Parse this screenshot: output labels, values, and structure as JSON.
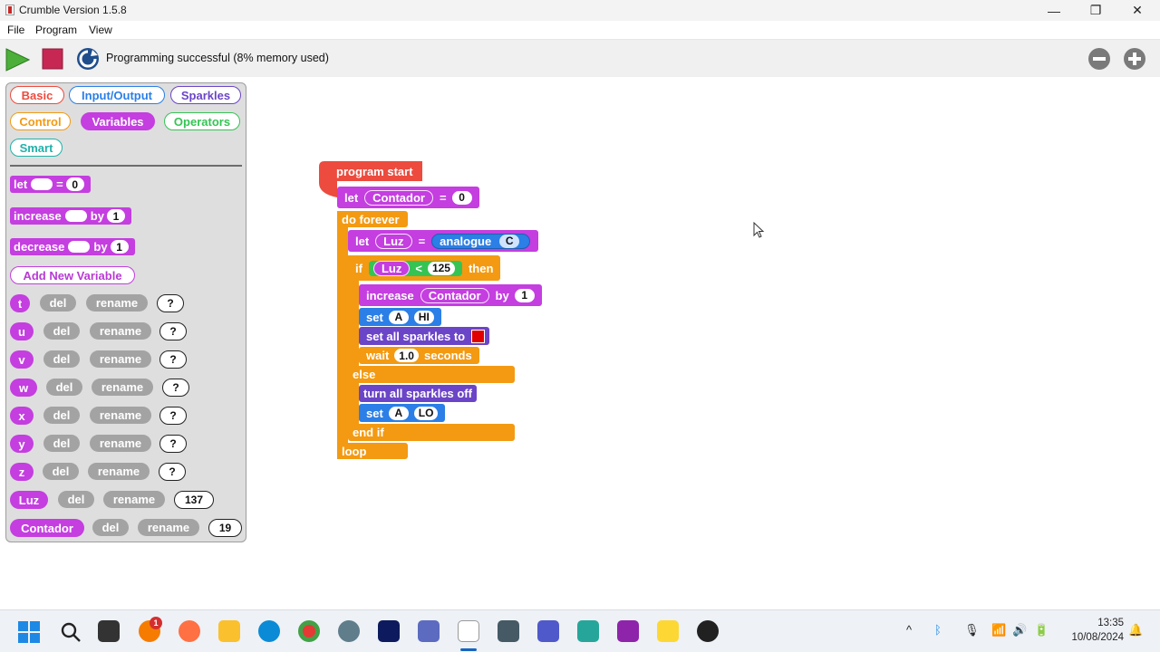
{
  "window": {
    "title": "Crumble Version 1.5.8",
    "minimize": "—",
    "maximize": "❐",
    "close": "✕"
  },
  "menu": [
    "File",
    "Program",
    "View"
  ],
  "toolbar": {
    "status": "Programming successful (8% memory used)",
    "zoom_out": "−",
    "zoom_in": "+"
  },
  "categories": {
    "basic": {
      "label": "Basic",
      "color": "#ec4b3e"
    },
    "io": {
      "label": "Input/Output",
      "color": "#2b7fe6"
    },
    "sparkles": {
      "label": "Sparkles",
      "color": "#6b45c7"
    },
    "control": {
      "label": "Control",
      "color": "#f39a12"
    },
    "variables": {
      "label": "Variables",
      "color": "#c43ee0"
    },
    "operators": {
      "label": "Operators",
      "color": "#35c454"
    },
    "smart": {
      "label": "Smart",
      "color": "#20b2aa"
    }
  },
  "palette_blocks": {
    "let": {
      "word": "let",
      "eq": "=",
      "value": "0"
    },
    "increase": {
      "word": "increase",
      "by": "by",
      "value": "1"
    },
    "decrease": {
      "word": "decrease",
      "by": "by",
      "value": "1"
    },
    "add_variable": "Add New Variable"
  },
  "var_actions": {
    "del": "del",
    "rename": "rename"
  },
  "variables": [
    {
      "name": "t",
      "value": "?"
    },
    {
      "name": "u",
      "value": "?"
    },
    {
      "name": "v",
      "value": "?"
    },
    {
      "name": "w",
      "value": "?"
    },
    {
      "name": "x",
      "value": "?"
    },
    {
      "name": "y",
      "value": "?"
    },
    {
      "name": "z",
      "value": "?"
    },
    {
      "name": "Luz",
      "value": "137"
    },
    {
      "name": "Contador",
      "value": "19"
    }
  ],
  "script": {
    "start": "program start",
    "let1": {
      "word": "let",
      "var": "Contador",
      "eq": "=",
      "value": "0"
    },
    "forever": "do forever",
    "let2": {
      "word": "let",
      "var": "Luz",
      "eq": "=",
      "fn": "analogue",
      "pin": "C"
    },
    "if": {
      "word": "if",
      "var": "Luz",
      "op": "<",
      "value": "125",
      "then": "then"
    },
    "increase": {
      "word": "increase",
      "var": "Contador",
      "by": "by",
      "value": "1"
    },
    "set_hi": {
      "word": "set",
      "pin": "A",
      "state": "HI"
    },
    "sparkles_to": {
      "text": "set all sparkles to",
      "color": "#e00000"
    },
    "wait": {
      "word": "wait",
      "value": "1.0",
      "unit": "seconds"
    },
    "else": "else",
    "sparkles_off": "turn all sparkles off",
    "set_lo": {
      "word": "set",
      "pin": "A",
      "state": "LO"
    },
    "end_if": "end if",
    "loop": "loop"
  },
  "taskbar": {
    "time": "13:35",
    "date": "10/08/2024",
    "badge": "1"
  }
}
